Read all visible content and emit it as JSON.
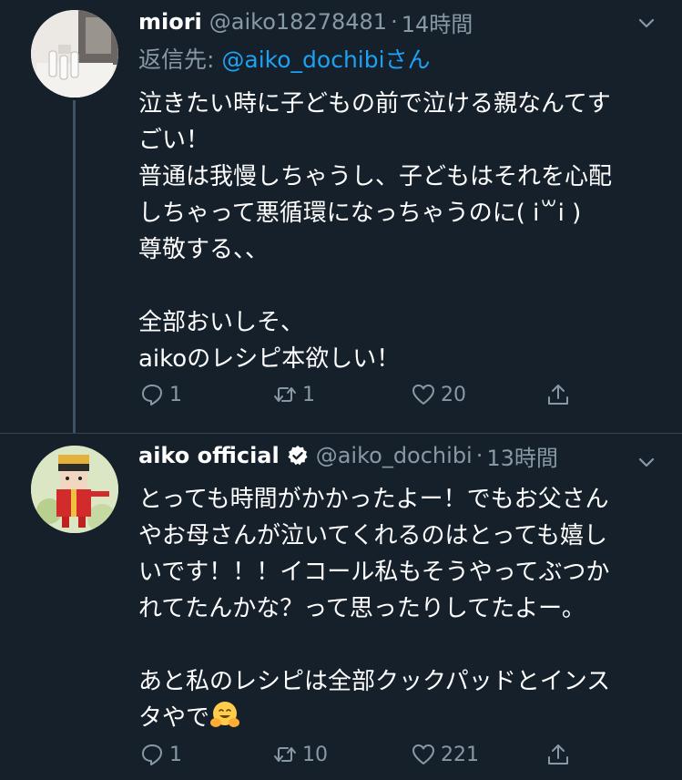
{
  "tweet1": {
    "name": "miori",
    "handle": "@aiko18278481",
    "dot": "·",
    "time": "14時間",
    "reply_prefix": "返信先:",
    "reply_mention": "@aiko_dochibiさん",
    "lines": [
      "泣きたい時に子どもの前で泣ける親なんてす",
      "ごい！",
      "普通は我慢しちゃうし、子どもはそれを心配",
      "しちゃって悪循環になっちゃうのに(  i꒳i )",
      "尊敬する、、",
      "",
      "全部おいしそ、",
      "aikoのレシピ本欲しい！"
    ],
    "replies": "1",
    "retweets": "1",
    "likes": "20"
  },
  "tweet2": {
    "name": "aiko official",
    "handle": "@aiko_dochibi",
    "dot": "·",
    "time": "13時間",
    "lines": [
      "とっても時間がかかったよー！でもお父さん",
      "やお母さんが泣いてくれるのはとっても嬉し",
      "いです！！！イコール私もそうやってぶつか",
      "れてたんかな？って思ったりしてたよー。",
      "",
      "あと私のレシピは全部クックパッドとインス",
      "タやで"
    ],
    "replies": "1",
    "retweets": "10",
    "likes": "221"
  },
  "icons": {
    "chevron": "chevron-down-icon",
    "reply": "reply-icon",
    "retweet": "retweet-icon",
    "like": "heart-icon",
    "share": "share-icon",
    "verified": "verified-badge-icon",
    "emoji": "hugging-face-emoji"
  },
  "colors": {
    "background": "#15202b",
    "secondary_text": "#8899a6",
    "link": "#1da1f2",
    "separator": "#38444d"
  }
}
